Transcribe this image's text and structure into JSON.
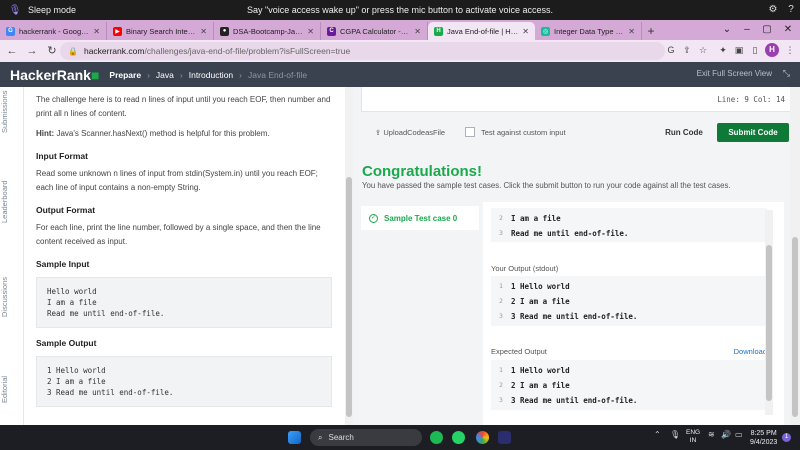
{
  "voice_bar": {
    "mode": "Sleep mode",
    "message": "Say \"voice access wake up\" or press the mic button to activate voice access."
  },
  "browser": {
    "tabs": [
      {
        "title": "hackerrank - Google Search",
        "fav_color": "#4285f4",
        "fav": "G"
      },
      {
        "title": "Binary Search Interview Qu...",
        "fav_color": "#ff0000",
        "fav": "▶"
      },
      {
        "title": "DSA-Bootcamp-Java/assig...",
        "fav_color": "#222222",
        "fav": "●"
      },
      {
        "title": "CGPA Calculator - Know Ho...",
        "fav_color": "#6a1b9a",
        "fav": "C"
      },
      {
        "title": "Java End-of-file | HackerRa...",
        "fav_color": "#1ba94c",
        "fav": "H"
      },
      {
        "title": "Integer Data Type Check",
        "fav_color": "#1abc9c",
        "fav": "◎"
      }
    ],
    "url_host": "hackerrank.com",
    "url_rest": "/challenges/java-end-of-file/problem?isFullScreen=true",
    "avatar_letter": "H"
  },
  "header": {
    "logo_main": "HackerRank",
    "crumbs": [
      "Prepare",
      "Java",
      "Introduction",
      "Java End-of-file"
    ],
    "exit_full_screen": "Exit Full Screen View"
  },
  "side_tabs": [
    "Submissions",
    "Leaderboard",
    "Discussions",
    "Editorial"
  ],
  "problem": {
    "intro_p1": "The challenge here is to read n lines of input until you reach EOF, then number and print all n lines of content.",
    "hint_label": "Hint:",
    "hint_text": " Java's Scanner.hasNext() method is helpful for this problem.",
    "input_format_title": "Input Format",
    "input_format_text": "Read some unknown n lines of input from stdin(System.in) until you reach EOF; each line of input contains a non-empty String.",
    "output_format_title": "Output Format",
    "output_format_text": "For each line, print the line number, followed by a single space, and then the line content received as input.",
    "sample_input_title": "Sample Input",
    "sample_input": [
      "Hello world",
      "I am a file",
      "Read me until end-of-file."
    ],
    "sample_output_title": "Sample Output",
    "sample_output": [
      "1 Hello world",
      "2 I am a file",
      "3 Read me until end-of-file."
    ]
  },
  "editor": {
    "line_col": "Line: 9  Col: 14",
    "upload": "UploadCodeasFile",
    "custom_input": "Test against custom input",
    "run": "Run Code",
    "submit": "Submit Code"
  },
  "result": {
    "congrats": "Congratulations!",
    "passed": "You have passed the sample test cases. Click the submit button to run your code against all the test cases.",
    "test_case": "Sample Test case 0",
    "input_lines": [
      {
        "n": "2",
        "text": "I am a file"
      },
      {
        "n": "3",
        "text": "Read me until end-of-file."
      }
    ],
    "your_output_label": "Your Output (stdout)",
    "your_output": [
      {
        "n": "1",
        "text": "1 Hello world"
      },
      {
        "n": "2",
        "text": "2 I am a file"
      },
      {
        "n": "3",
        "text": "3 Read me until end-of-file."
      }
    ],
    "expected_label": "Expected Output",
    "download": "Download",
    "expected": [
      {
        "n": "1",
        "text": "1 Hello world"
      },
      {
        "n": "2",
        "text": "2 I am a file"
      },
      {
        "n": "3",
        "text": "3 Read me until end-of-file."
      }
    ]
  },
  "taskbar": {
    "search": "Search",
    "lang_top": "ENG",
    "lang_bottom": "IN",
    "time": "8:25 PM",
    "date": "9/4/2023",
    "notif_count": "1"
  }
}
